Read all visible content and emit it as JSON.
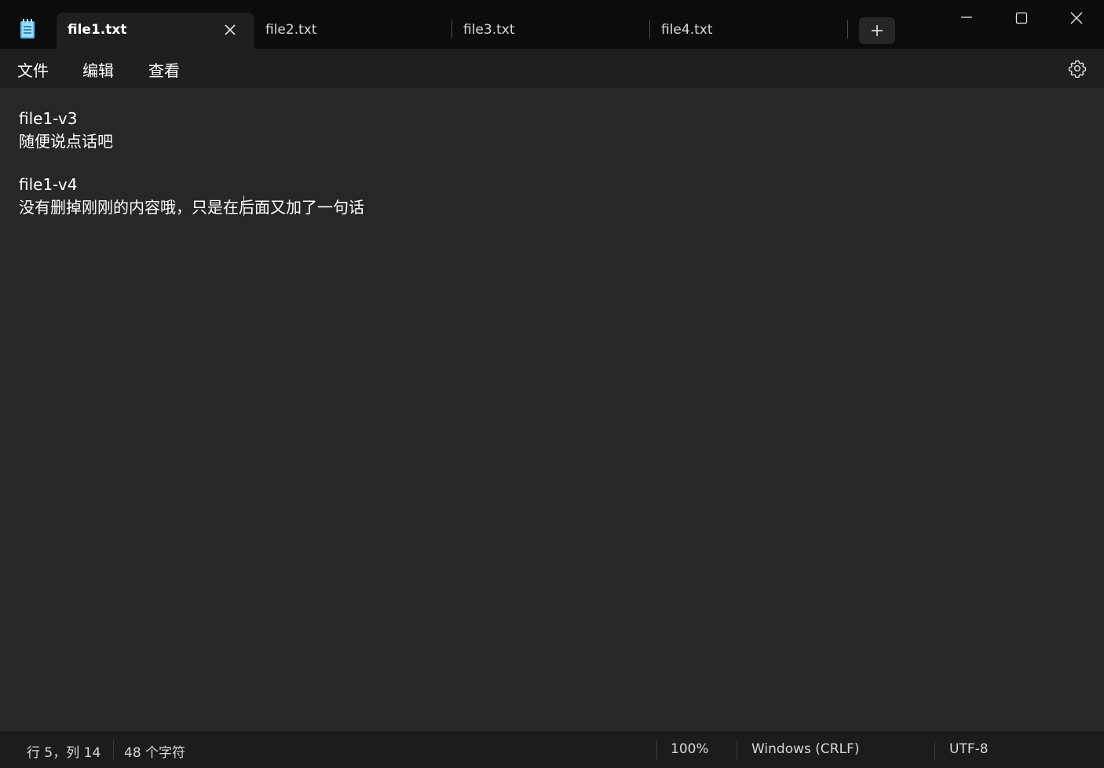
{
  "tabs": [
    {
      "label": "file1.txt",
      "active": true
    },
    {
      "label": "file2.txt",
      "active": false
    },
    {
      "label": "file3.txt",
      "active": false
    },
    {
      "label": "file4.txt",
      "active": false
    }
  ],
  "menu": {
    "file": "文件",
    "edit": "编辑",
    "view": "查看"
  },
  "document": {
    "lines": [
      "file1-v3",
      "随便说点话吧",
      "",
      "file1-v4",
      "没有删掉刚刚的内容哦，只是在后面又加了一句话"
    ]
  },
  "status": {
    "position": "行 5，列 14",
    "char_count": "48 个字符",
    "zoom": "100%",
    "line_ending": "Windows (CRLF)",
    "encoding": "UTF-8"
  },
  "icons": {
    "app": "notepad-icon",
    "close_tab": "close-icon",
    "new_tab": "plus-icon",
    "minimize": "minimize-icon",
    "maximize": "maximize-icon",
    "close_window": "close-icon",
    "settings": "gear-icon"
  },
  "colors": {
    "titlebar": "#0c0c0c",
    "active_tab": "#1f1f1f",
    "editor_bg": "#272727",
    "app_icon": "#4cc2ff"
  }
}
